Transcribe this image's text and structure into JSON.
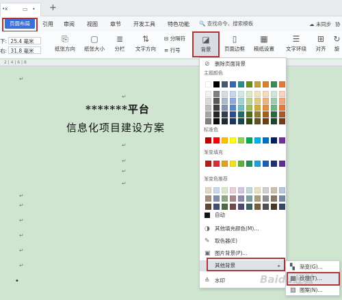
{
  "tabstrip": {
    "doc_tab": "•x",
    "plus": "+"
  },
  "ribbon_tabs": {
    "active": "页面布局",
    "items": [
      "引用",
      "审阅",
      "视图",
      "章节",
      "开发工具",
      "特色功能"
    ],
    "search": "查找命令、搜索模板",
    "right": [
      "未同步",
      "协"
    ]
  },
  "ribbon": {
    "margin_top_label": "下:",
    "margin_top_value": "25.4 毫米",
    "margin_right_label": "右:",
    "margin_right_value": "31.8 毫米",
    "buttons": [
      "纸张方向",
      "纸张大小",
      "分栏",
      "文字方向",
      "背景",
      "页面边框",
      "稿纸设置",
      "文字环绕",
      "对齐",
      "旋"
    ],
    "small": [
      "分隔符",
      "行号"
    ]
  },
  "ruler": "2 | 4 | 6 | 8",
  "document": {
    "line1": "*******平台",
    "line2": "信息化项目建设方案"
  },
  "dropdown": {
    "delete_bg": "删除页面背景",
    "theme_colors": "主题颜色",
    "standard_colors": "标准色",
    "gradient_fill": "渐变填充",
    "gradient_recommend": "渐变色推荐",
    "auto": "自动",
    "other_fill": "其他填充颜色(M)...",
    "eyedropper": "取色器(E)",
    "picture_bg": "图片背景(P)...",
    "other_bg": "其他背景",
    "watermark": "水印"
  },
  "submenu": {
    "gradient": "渐变(G)...",
    "texture": "纹理(T)...",
    "pattern": "图案(N)..."
  },
  "colors": {
    "accent_blue": "#3b6fd8",
    "highlight_red": "#b03333",
    "doc_background": "#cfe5cf"
  },
  "site_watermark": "Baidu经验"
}
